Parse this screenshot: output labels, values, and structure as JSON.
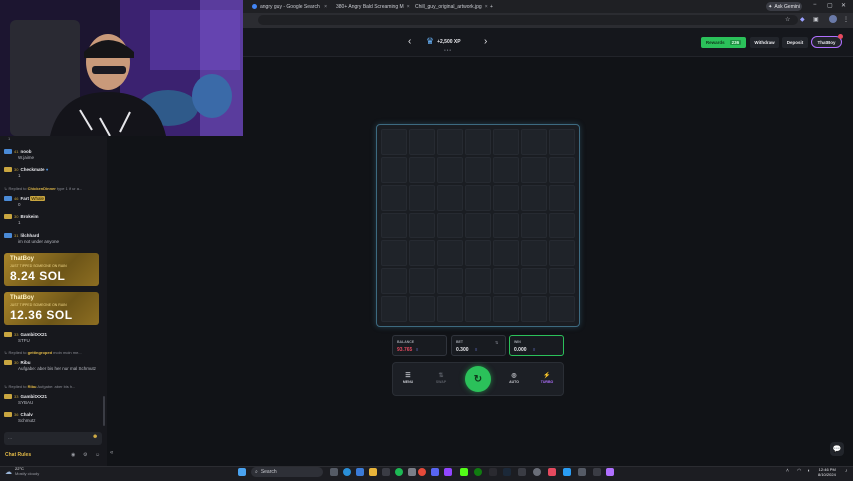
{
  "browser": {
    "tabs": [
      {
        "title": "angry guy - Google Search",
        "color": "#4285f4"
      },
      {
        "title": "380+ Angry Bald Screaming M",
        "color": "#3aa0e8"
      },
      {
        "title": "Chill_guy_original_artwork.jpg",
        "color": "#6ab04c"
      }
    ],
    "new_tab": "+",
    "ask_gemini": "Ask Gemini",
    "window_min": "−",
    "window_max": "▢",
    "window_close": "✕"
  },
  "header": {
    "prev": "‹",
    "next": "›",
    "race_amount": "+2,500 XP",
    "rewards_label": "Rewards",
    "rewards_count": "236",
    "withdraw_label": "Withdraw",
    "deposit_label": "Deposit",
    "username": "ThatBoy"
  },
  "chat": {
    "messages": [
      {
        "level": "41",
        "user": "noob",
        "text": "W.jaime",
        "badge_color": "#4a8ad6"
      },
      {
        "level": "30",
        "user": "Checkmate",
        "text": "1",
        "badge_color": "#c9a640"
      },
      {
        "reply_to": "ChickenDinner",
        "reply_text": "type 1 if ur a..."
      },
      {
        "level": "46",
        "user": "Fart",
        "text": "0",
        "badge_color": "#4a8ad6",
        "tag": "Whale"
      },
      {
        "level": "30",
        "user": "Brokeim",
        "text": "1",
        "badge_color": "#c9a640"
      },
      {
        "level": "31",
        "user": "lilchhard",
        "text": "im not under anyone",
        "badge_color": "#4a8ad6"
      },
      {
        "level": "33",
        "user": "GambitXX21",
        "text": "STFU",
        "badge_color": "#c9a640"
      },
      {
        "reply_to": "gettingroped",
        "reply_text": "moin moin me..."
      },
      {
        "level": "30",
        "user": "Ribu",
        "text": "Aufgabe: aber bis her nur mal Schmutz",
        "badge_color": "#c9a640"
      },
      {
        "reply_to": "Ribu",
        "reply_text": "Aufgabe: aber bis h..."
      },
      {
        "level": "33",
        "user": "GambitXX21",
        "text": "SYBAU",
        "badge_color": "#c9a640"
      },
      {
        "level": "36",
        "user": "Chalv",
        "text": "Schmutz",
        "badge_color": "#c9a640"
      }
    ],
    "tips": [
      {
        "name": "ThatBoy",
        "subtitle": "JUST TIPPED SOMEONE ON RAIN",
        "amount": "8.24 SOL"
      },
      {
        "name": "ThatBoy",
        "subtitle": "JUST TIPPED SOMEONE ON RAIN",
        "amount": "12.36 SOL"
      }
    ],
    "input_placeholder": "...",
    "rules_label": "Chat Rules"
  },
  "game": {
    "grid_rows": 7,
    "grid_cols": 7,
    "balance_label": "BALANCE",
    "balance_value": "93.765",
    "bet_label": "BET",
    "bet_value": "0.300",
    "win_label": "WIN",
    "win_value": "0.000",
    "controls": {
      "menu": "MENU",
      "swap": "SWAP",
      "play": "↻",
      "auto": "AUTO",
      "turbo": "TURBO"
    },
    "colors": {
      "balance": "#e64a5f",
      "win": "#2bc15a",
      "turbo": "#b070ff"
    }
  },
  "taskbar": {
    "weather_temp": "22°C",
    "weather_desc": "Mostly cloudy",
    "search_placeholder": "Search",
    "time": "12:46 PM",
    "date": "8/10/2024"
  }
}
